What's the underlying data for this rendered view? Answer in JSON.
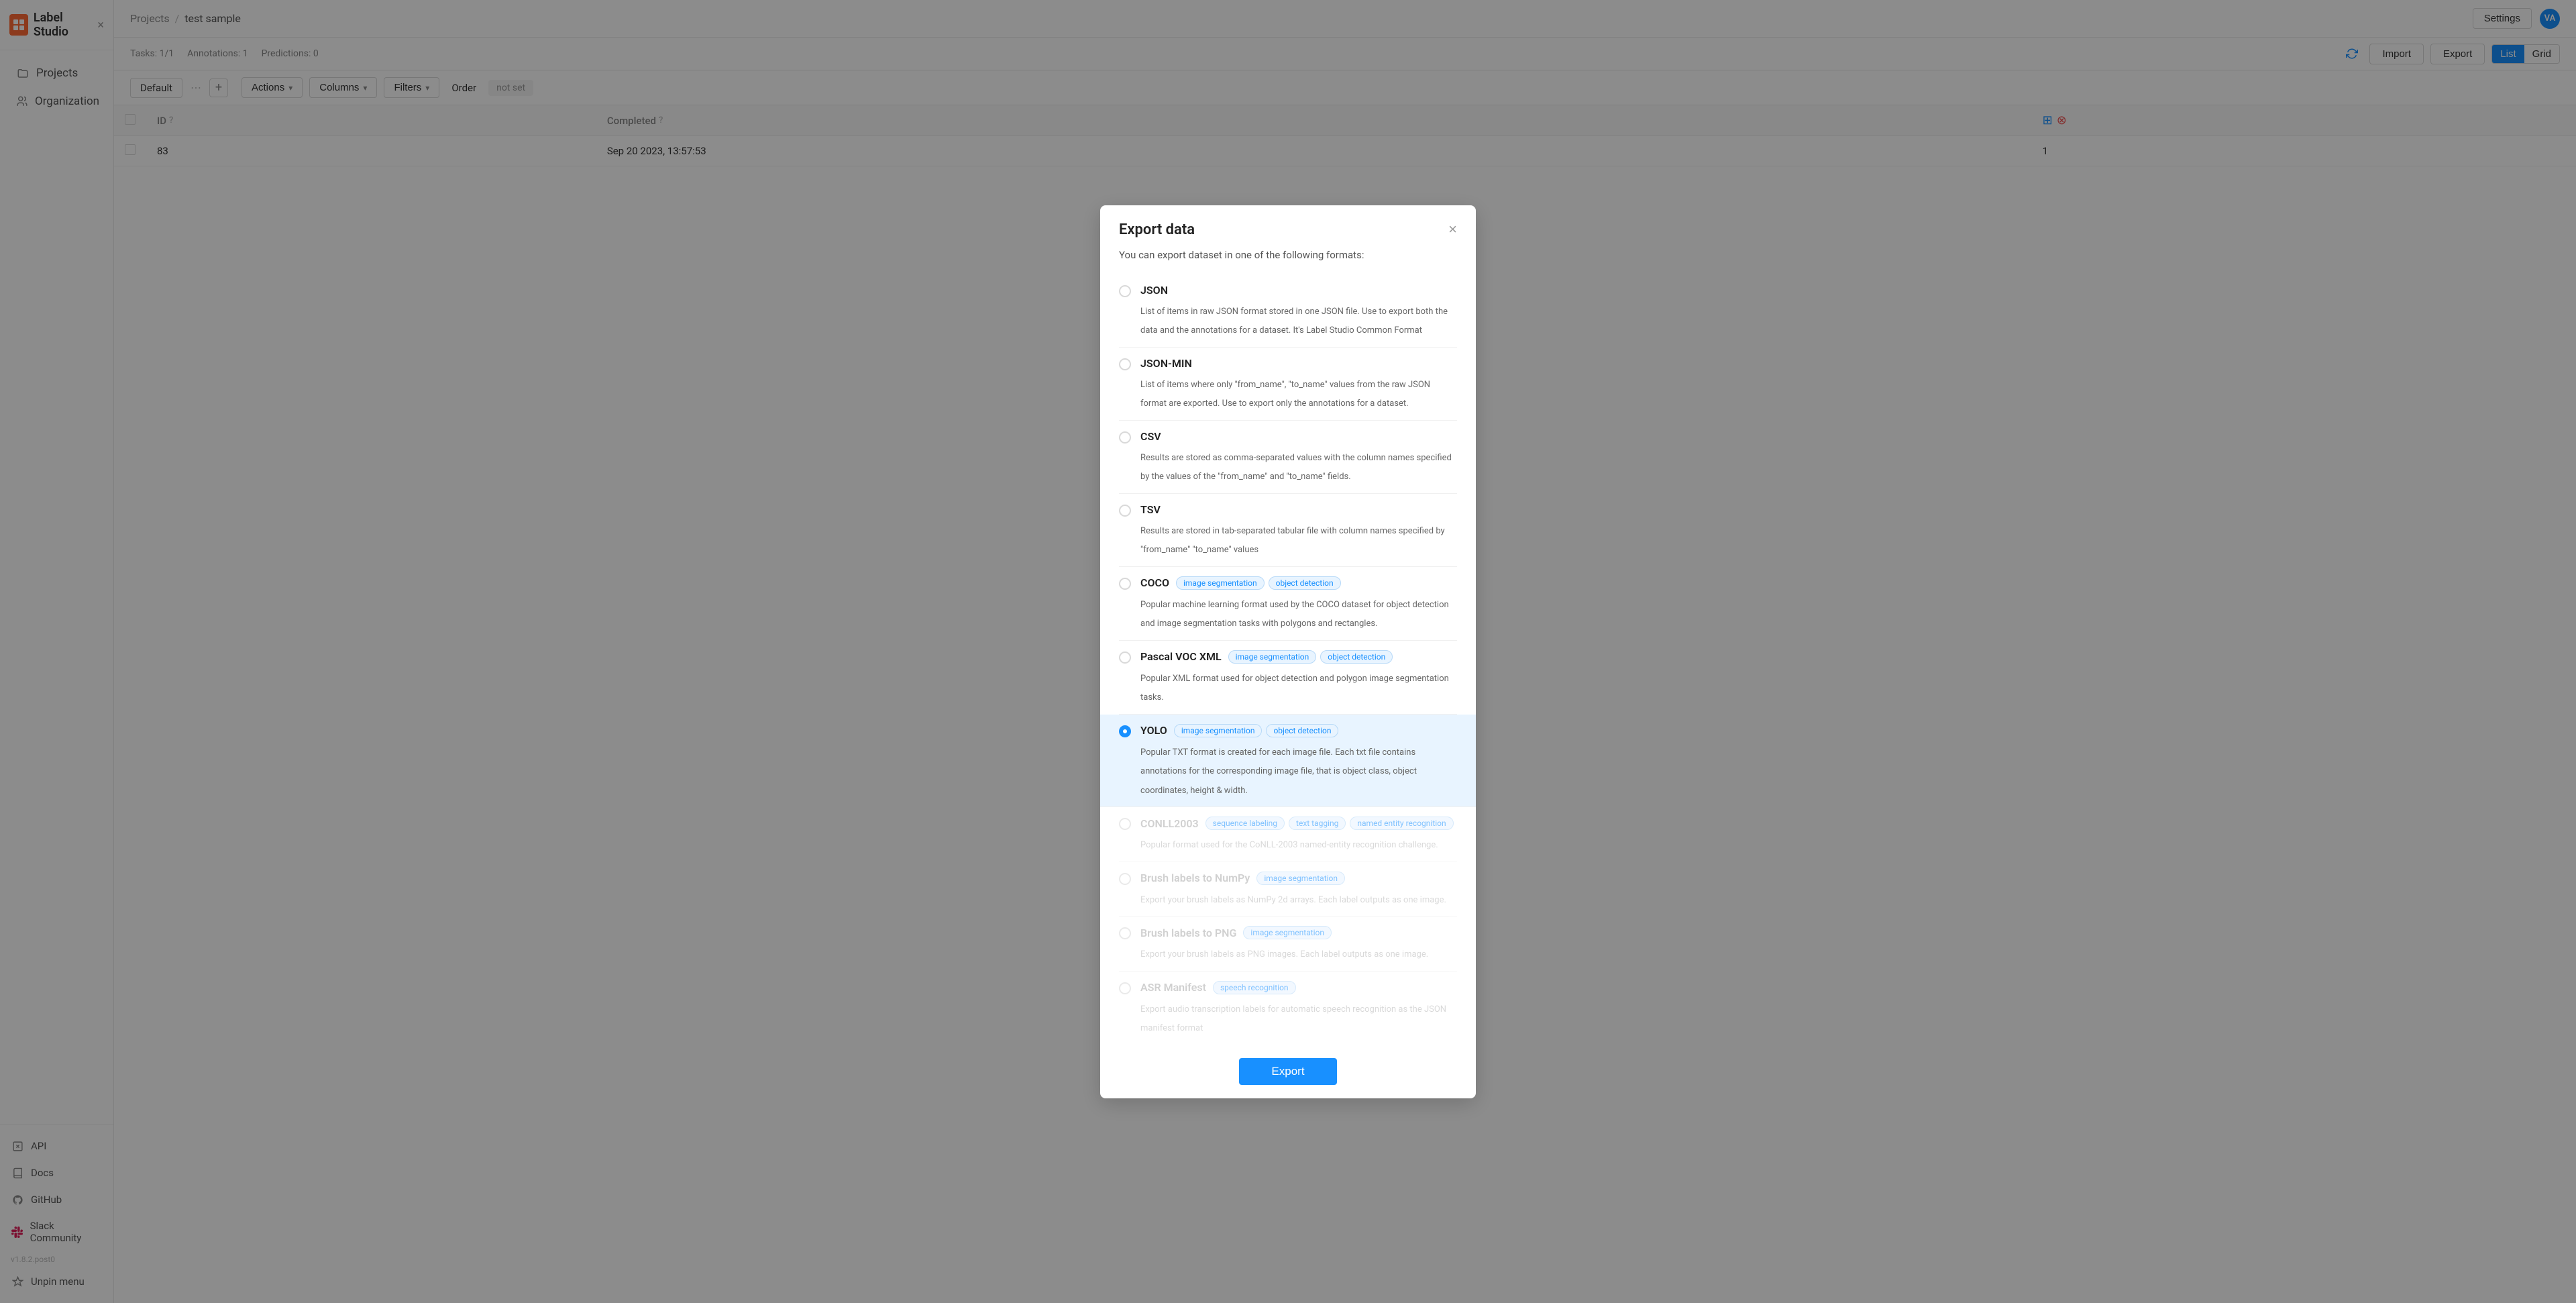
{
  "app": {
    "logo_text": "Label Studio",
    "close_label": "×"
  },
  "sidebar": {
    "items": [
      {
        "id": "projects",
        "label": "Projects",
        "icon": "folder"
      },
      {
        "id": "organization",
        "label": "Organization",
        "icon": "team"
      }
    ],
    "bottom_items": [
      {
        "id": "api",
        "label": "API",
        "icon": "api"
      },
      {
        "id": "docs",
        "label": "Docs",
        "icon": "book"
      },
      {
        "id": "github",
        "label": "GitHub",
        "icon": "github"
      },
      {
        "id": "slack",
        "label": "Slack Community",
        "icon": "slack"
      }
    ],
    "version": "v1.8.2.post0",
    "unpin_label": "Unpin menu"
  },
  "topbar": {
    "breadcrumb_root": "Projects",
    "breadcrumb_sep": "/",
    "breadcrumb_current": "test sample",
    "settings_label": "Settings",
    "avatar_initials": "VA"
  },
  "subheader": {
    "tab_label": "Default",
    "actions_label": "Actions",
    "columns_label": "Columns",
    "filters_label": "Filters",
    "order_label": "Order",
    "not_set_label": "not set"
  },
  "stats_bar": {
    "tasks_label": "Tasks: 1/1",
    "annotations_label": "Annotations: 1",
    "predictions_label": "Predictions: 0",
    "import_label": "Import",
    "export_label": "Export",
    "list_label": "List",
    "grid_label": "Grid"
  },
  "table": {
    "columns": [
      {
        "id": "id",
        "label": "ID"
      },
      {
        "id": "completed",
        "label": "Completed"
      },
      {
        "id": "extra",
        "label": ""
      }
    ],
    "rows": [
      {
        "id": "83",
        "completed": "Sep 20 2023, 13:57:53",
        "count": "1"
      }
    ]
  },
  "modal": {
    "title": "Export data",
    "subtitle": "You can export dataset in one of the following formats:",
    "close_label": "×",
    "export_button": "Export",
    "formats": [
      {
        "id": "json",
        "name": "JSON",
        "description": "List of items in raw JSON format stored in one JSON file. Use to export both the data and the annotations for a dataset. It's Label Studio Common Format",
        "tags": [],
        "selected": false,
        "dimmed": false
      },
      {
        "id": "json-min",
        "name": "JSON-MIN",
        "description": "List of items where only \"from_name\", \"to_name\" values from the raw JSON format are exported. Use to export only the annotations for a dataset.",
        "tags": [],
        "selected": false,
        "dimmed": false
      },
      {
        "id": "csv",
        "name": "CSV",
        "description": "Results are stored as comma-separated values with the column names specified by the values of the \"from_name\" and \"to_name\" fields.",
        "tags": [],
        "selected": false,
        "dimmed": false
      },
      {
        "id": "tsv",
        "name": "TSV",
        "description": "Results are stored in tab-separated tabular file with column names specified by \"from_name\" \"to_name\" values",
        "tags": [],
        "selected": false,
        "dimmed": false
      },
      {
        "id": "coco",
        "name": "COCO",
        "description": "Popular machine learning format used by the COCO dataset for object detection and image segmentation tasks with polygons and rectangles.",
        "tags": [
          "image segmentation",
          "object detection"
        ],
        "selected": false,
        "dimmed": false
      },
      {
        "id": "pascal-voc",
        "name": "Pascal VOC XML",
        "description": "Popular XML format used for object detection and polygon image segmentation tasks.",
        "tags": [
          "image segmentation",
          "object detection"
        ],
        "selected": false,
        "dimmed": false
      },
      {
        "id": "yolo",
        "name": "YOLO",
        "description": "Popular TXT format is created for each image file. Each txt file contains annotations for the corresponding image file, that is object class, object coordinates, height & width.",
        "tags": [
          "image segmentation",
          "object detection"
        ],
        "selected": true,
        "dimmed": false
      },
      {
        "id": "conll2003",
        "name": "CONLL2003",
        "description": "Popular format used for the CoNLL-2003 named-entity recognition challenge.",
        "tags": [
          "sequence labeling",
          "text tagging",
          "named entity recognition"
        ],
        "selected": false,
        "dimmed": true
      },
      {
        "id": "brush-numpy",
        "name": "Brush labels to NumPy",
        "description": "Export your brush labels as NumPy 2d arrays. Each label outputs as one image.",
        "tags": [
          "image segmentation"
        ],
        "selected": false,
        "dimmed": true
      },
      {
        "id": "brush-png",
        "name": "Brush labels to PNG",
        "description": "Export your brush labels as PNG images. Each label outputs as one image.",
        "tags": [
          "image segmentation"
        ],
        "selected": false,
        "dimmed": true
      },
      {
        "id": "asr-manifest",
        "name": "ASR Manifest",
        "description": "Export audio transcription labels for automatic speech recognition as the JSON manifest format",
        "tags": [
          "speech recognition"
        ],
        "selected": false,
        "dimmed": true
      }
    ]
  }
}
